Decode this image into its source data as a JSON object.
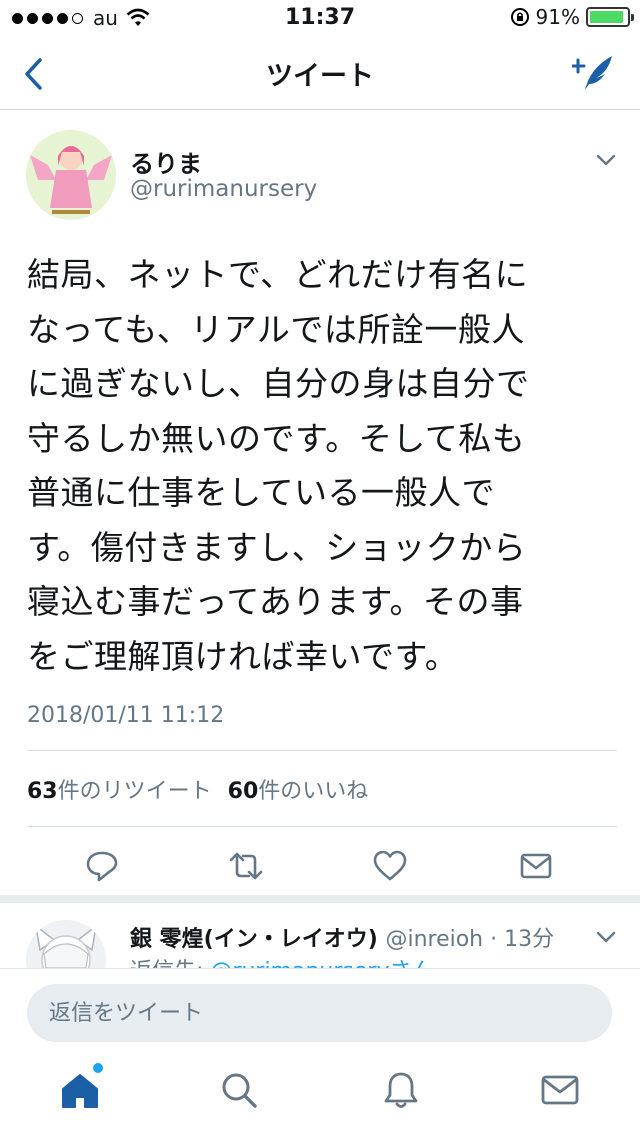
{
  "status_bar": {
    "carrier": "au",
    "time": "11:37",
    "battery": "91%",
    "battery_level": 0.91
  },
  "nav": {
    "title": "ツイート",
    "back_icon": "chevron-left-icon",
    "compose_icon": "compose-quill-icon"
  },
  "tweet": {
    "display_name": "るりま",
    "username": "@rurimanursery",
    "lines": [
      "結局、ネットで、どれだけ有名に",
      "なっても、リアルでは所詮一般人",
      "に過ぎないし、自分の身は自分で",
      "守るしか無いのです。そして私も",
      "普通に仕事をしている一般人で",
      "す。傷付きますし、ショックから",
      "寝込む事だってあります。その事",
      "をご理解頂ければ幸いです。"
    ],
    "date": "2018/01/11 11:12",
    "retweet_count": "63",
    "retweet_label": "件のリツイート",
    "like_count": "60",
    "like_label": "件のいいね"
  },
  "reply_preview": {
    "name": "銀 零煌(イン・レイオウ)",
    "handle_time": "@inreioh · 13分",
    "reply_to_prefix": "返信先: ",
    "reply_to_user": "@rurimanurseryさん"
  },
  "composer": {
    "placeholder": "返信をツイート"
  },
  "colors": {
    "accent": "#1da1f2",
    "nav_icon": "#1b5fa6",
    "muted": "#657786"
  }
}
